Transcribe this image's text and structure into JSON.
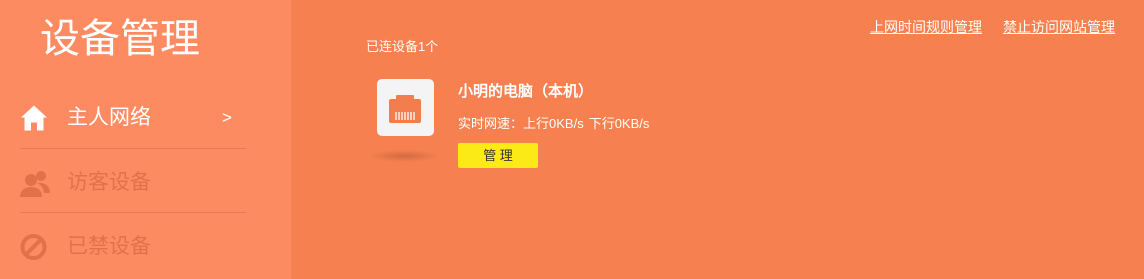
{
  "colors": {
    "sidebar_bg": "#FD8B62",
    "main_bg": "#F6804F",
    "dimmed_text": "#E4704A",
    "button_bg": "#FCEA17",
    "port_icon": "#F47D4E"
  },
  "sidebar": {
    "title": "设备管理",
    "items": [
      {
        "label": "主人网络",
        "icon": "home-icon",
        "arrow": ">",
        "active": true
      },
      {
        "label": "访客设备",
        "icon": "users-icon",
        "active": false
      },
      {
        "label": "已禁设备",
        "icon": "ban-icon",
        "active": false
      }
    ]
  },
  "header": {
    "links": [
      "上网时间规则管理",
      "禁止访问网站管理"
    ]
  },
  "main": {
    "connected_count_text": "已连设备1个",
    "devices": [
      {
        "icon": "ethernet-port-icon",
        "name": "小明的电脑（本机）",
        "speed_label": "实时网速：",
        "upload": "上行0KB/s",
        "download": "下行0KB/s",
        "manage_label": "管 理"
      }
    ]
  }
}
